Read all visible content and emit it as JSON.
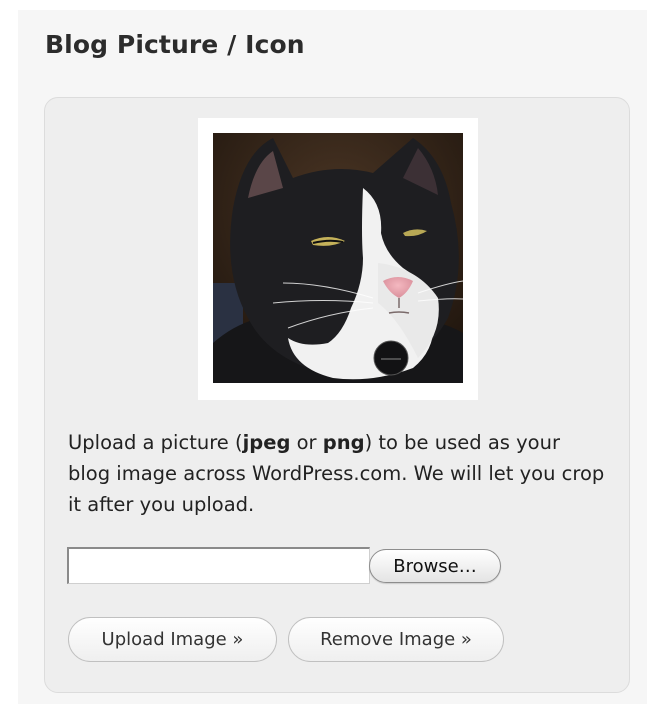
{
  "section": {
    "title": "Blog Picture / Icon"
  },
  "description": {
    "text_1": "Upload a picture (",
    "format_1": "jpeg",
    "text_2": " or ",
    "format_2": "png",
    "text_3": ") to be used as your blog image across WordPress.com. We will let you crop it after you upload."
  },
  "file_picker": {
    "value": "",
    "browse_label": "Browse…"
  },
  "actions": {
    "upload_label": "Upload Image »",
    "remove_label": "Remove Image »"
  },
  "colors": {
    "panel_background": "#eeeeee",
    "heading_text": "#2c2c2c",
    "cat_fur_black": "#1c1c1e",
    "cat_fur_white": "#f2f2f2"
  }
}
